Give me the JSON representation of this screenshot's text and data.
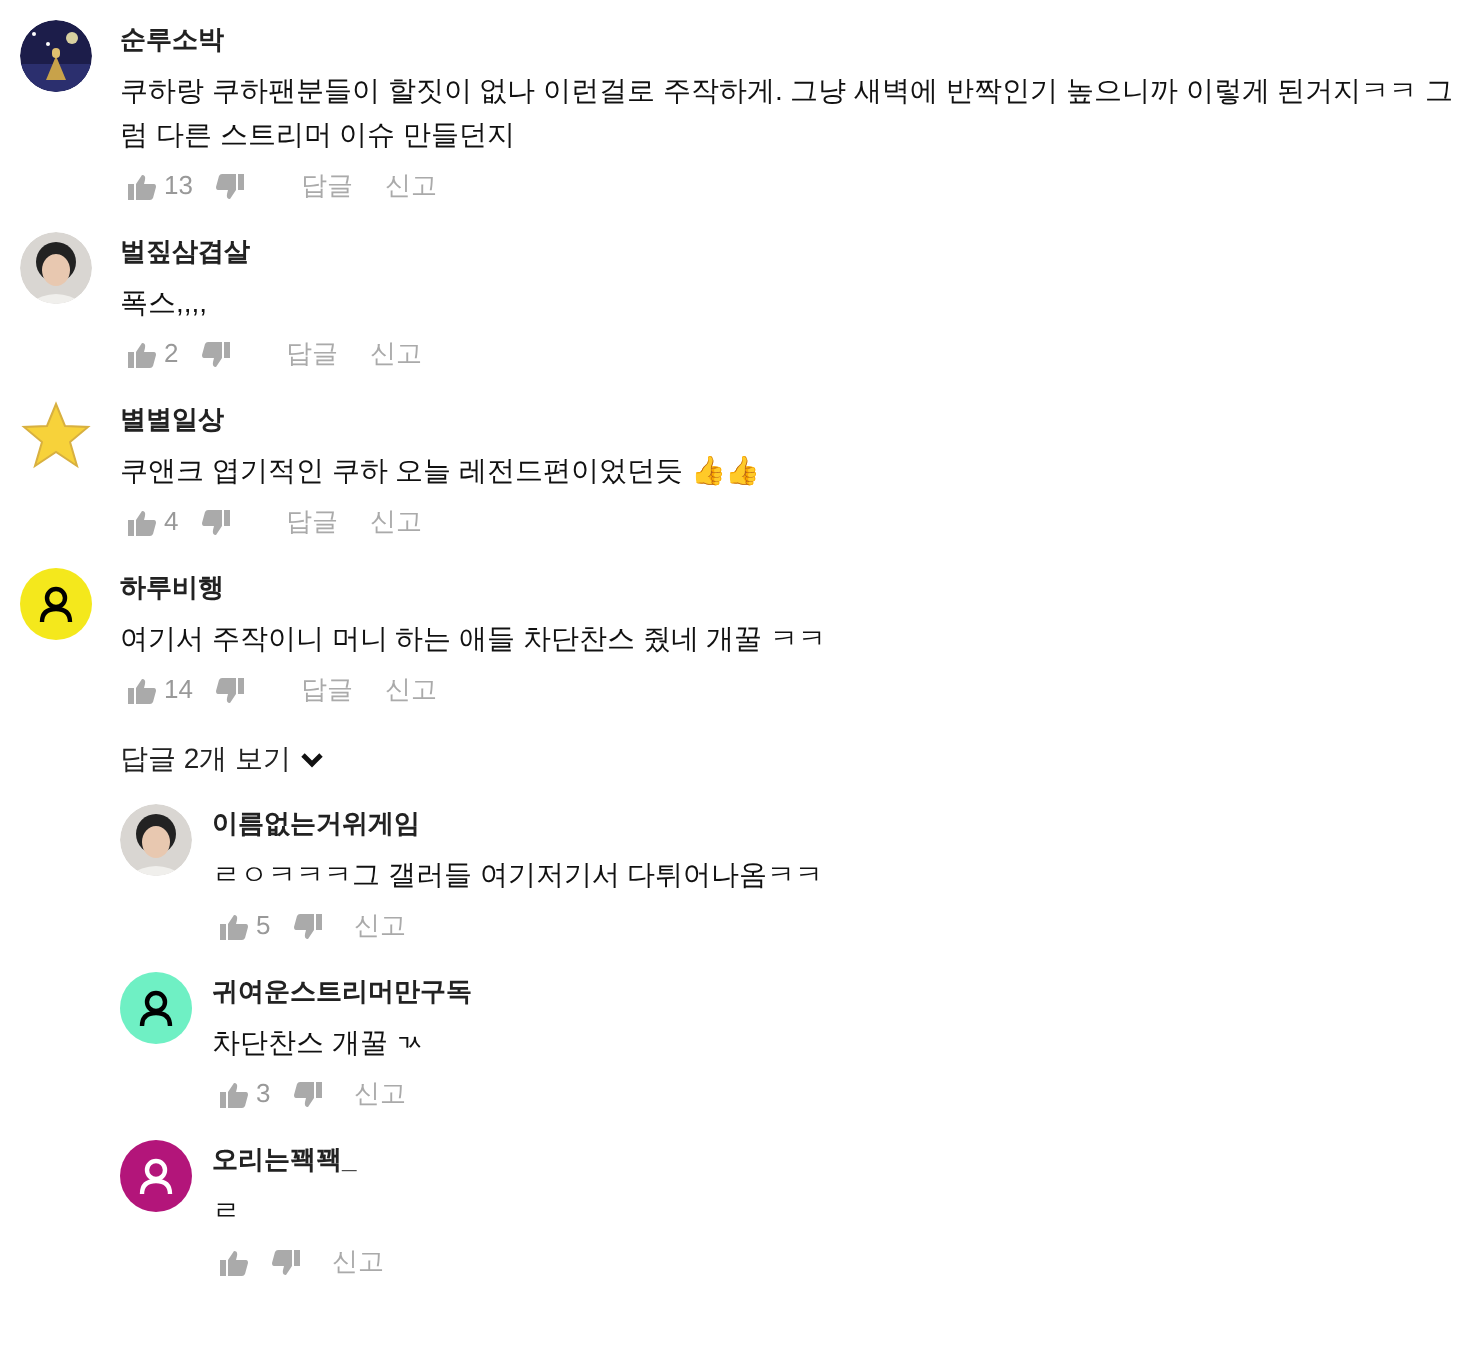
{
  "comments": [
    {
      "author": "순루소박",
      "text": "쿠하랑 쿠하팬분들이 할짓이 없나 이런걸로 주작하게. 그냥 새벽에 반짝인기 높으니까 이렇게 된거지ㅋㅋ 그럼 다른 스트리머 이슈 만들던지",
      "likes": "13",
      "reply_label": "답글",
      "report_label": "신고"
    },
    {
      "author": "벌짚삼겹살",
      "text": "폭스,,,,",
      "likes": "2",
      "reply_label": "답글",
      "report_label": "신고"
    },
    {
      "author": "별별일상",
      "avatar": {
        "kind": "star"
      },
      "text": "쿠앤크 엽기적인 쿠하 오늘 레전드편이었던듯 👍👍",
      "likes": "4",
      "reply_label": "답글",
      "report_label": "신고"
    },
    {
      "author": "하루비행",
      "avatar": {
        "kind": "default",
        "color": "#f4e81c"
      },
      "text": "여기서 주작이니 머니 하는 애들 차단찬스 줬네 개꿀 ㅋㅋ",
      "likes": "14",
      "reply_label": "답글",
      "report_label": "신고",
      "replies_toggle": {
        "label": "답글 2개 보기",
        "expanded": true
      },
      "replies": [
        {
          "author": "이름없는거위게임",
          "text": "ㄹㅇㅋㅋㅋ그 갤러들 여기저기서 다튀어나옴ㅋㅋ",
          "likes": "5",
          "report_label": "신고"
        },
        {
          "author": "귀여운스트리머만구독",
          "avatar": {
            "kind": "default",
            "color": "#6ff0c4"
          },
          "text": "차단찬스 개꿀 ㄳ",
          "likes": "3",
          "report_label": "신고"
        },
        {
          "author": "오리는꽥꽥_",
          "avatar": {
            "kind": "default",
            "color": "#b3157a"
          },
          "text": "ㄹ",
          "report_label": "신고"
        }
      ]
    }
  ]
}
